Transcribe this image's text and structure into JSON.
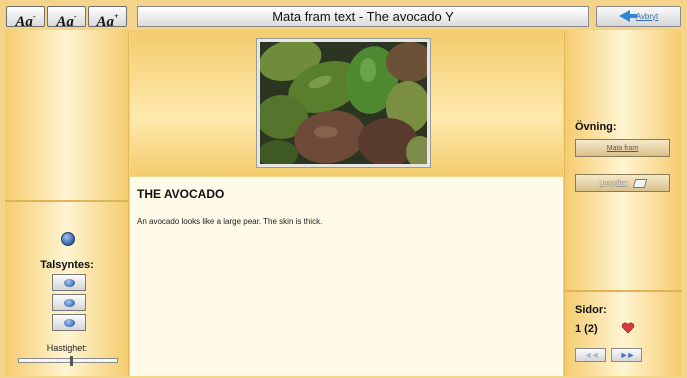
{
  "window": {
    "title": "Mata fram text - The avocado  Y"
  },
  "font_buttons": [
    {
      "label": "Aa",
      "mark": "-"
    },
    {
      "label": "Aa",
      "mark": "-"
    },
    {
      "label": "Aa",
      "mark": "+"
    }
  ],
  "back_button": {
    "label": "Avbryt",
    "icon": "back-arrow-icon"
  },
  "left_panel": {
    "speaker_icon": "speaker-icon",
    "talsyntes_label": "Talsyntes:",
    "speech_buttons": [
      "play-icon",
      "pause-icon",
      "stop-icon"
    ],
    "speed_label": "Hastighet:",
    "speed_value": 0.53
  },
  "content": {
    "heading": "THE AVOCADO",
    "body": "An avocado looks like a large pear. The skin is thick.",
    "image_subject": "avocados-photo"
  },
  "right_panel": {
    "exercise_label": "Övning:",
    "show_button_label": "Mata fram",
    "check_button_label": "Uppgifter",
    "pages_label": "Sidor:",
    "page_indicator": "1 (2)",
    "prev_label": "◄◄",
    "next_label": "►►"
  },
  "colors": {
    "panel_gold": "#f4cc6e",
    "text_bg": "#fffbe8",
    "accent_blue": "#2f86d6",
    "heart_red": "#d93a3a"
  }
}
